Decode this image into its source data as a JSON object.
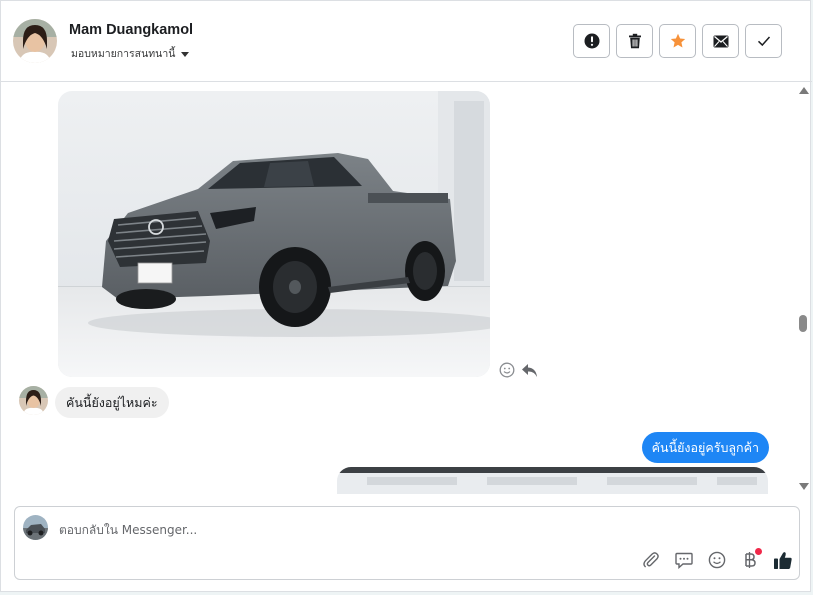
{
  "header": {
    "contact_name": "Mam Duangkamol",
    "assign_label": "มอบหมายการสนทนานี้",
    "actions": [
      {
        "icon": "alert-icon"
      },
      {
        "icon": "trash-icon"
      },
      {
        "icon": "star-icon",
        "color": "#f7923a"
      },
      {
        "icon": "envelope-icon"
      },
      {
        "icon": "checkmark-icon"
      }
    ]
  },
  "messages": {
    "incoming_text": "คันนี้ยังอยู่ไหมค่ะ",
    "outgoing_text": "คันนี้ยังอยู่ครับลูกค้า"
  },
  "composer": {
    "placeholder": "ตอบกลับใน Messenger...",
    "tools": [
      "attach-icon",
      "chat-bubble-icon",
      "emoji-icon",
      "baht-icon",
      "thumbs-up-icon"
    ]
  },
  "colors": {
    "accent_blue": "#1e86f5",
    "incoming_bubble": "#f0f0f0",
    "notification_red": "#f02849"
  }
}
